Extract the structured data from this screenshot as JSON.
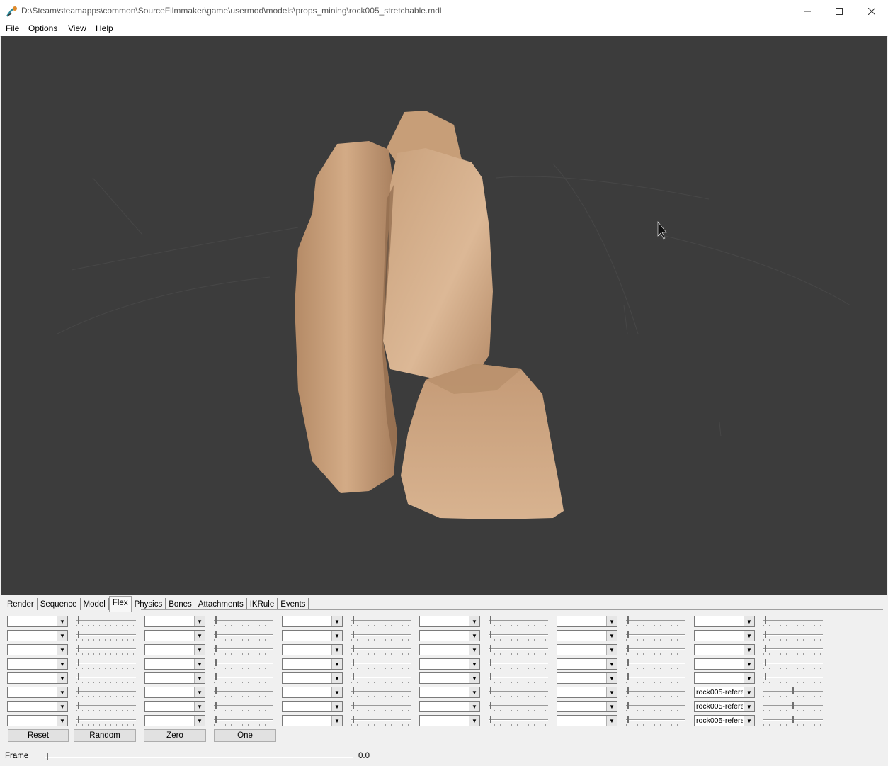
{
  "window": {
    "title": "D:\\Steam\\steamapps\\common\\SourceFilmmaker\\game\\usermod\\models\\props_mining\\rock005_stretchable.mdl"
  },
  "menu": [
    "File",
    "Options",
    "View",
    "Help"
  ],
  "tabs": [
    "Render",
    "Sequence",
    "Model",
    "Flex",
    "Physics",
    "Bones",
    "Attachments",
    "IKRule",
    "Events"
  ],
  "active_tab": "Flex",
  "flex": {
    "combo_values": {
      "col5_row5": "rock005-refere",
      "col5_row6": "rock005-refere",
      "col5_row7": "rock005-refere"
    },
    "slider_levels": {
      "default": 0.0,
      "col5_row5": 0.5,
      "col5_row6": 0.5,
      "col5_row7": 0.5
    },
    "buttons": [
      "Reset",
      "Random",
      "Zero",
      "One"
    ]
  },
  "status": {
    "frame_label": "Frame",
    "frame_value": "0.0"
  },
  "colors": {
    "viewport_bg": "#3c3c3c",
    "rock": "#c9a17c"
  }
}
